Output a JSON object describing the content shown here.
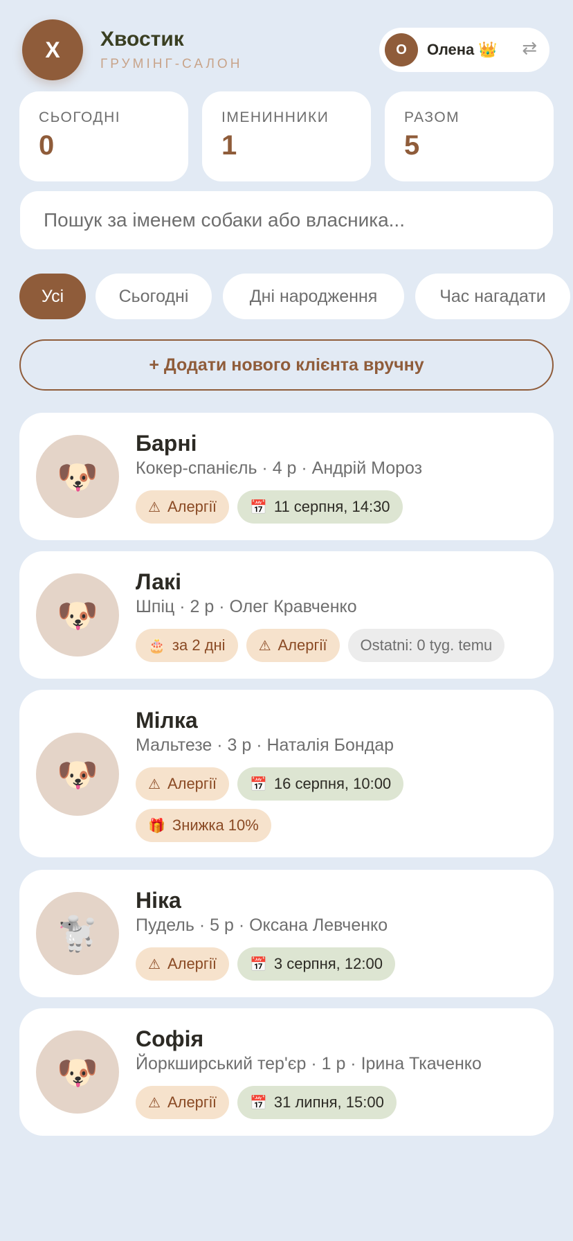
{
  "brand": {
    "initial": "Х",
    "name": "Хвостик",
    "subtitle": "ГРУМІНГ-САЛОН"
  },
  "user": {
    "initial": "О",
    "name": "Олена 👑",
    "switch_icon": "⇄"
  },
  "stats": [
    {
      "label": "СЬОГОДНІ",
      "value": "0"
    },
    {
      "label": "ІМЕНИННИКИ",
      "value": "1"
    },
    {
      "label": "РАЗОМ",
      "value": "5"
    }
  ],
  "search": {
    "placeholder": "Пошук за іменем собаки або власника..."
  },
  "filters": [
    "Усі",
    "Сьогодні",
    "Дні народження",
    "Час нагадати"
  ],
  "add_button": "+ Додати нового клієнта вручну",
  "clients": [
    {
      "avatar": "🐶",
      "name": "Барні",
      "meta": "Кокер-спанієль · 4 р · Андрій Мороз",
      "tags": [
        {
          "kind": "allergy",
          "icon": "⚠",
          "text": "Алергії"
        },
        {
          "kind": "date",
          "icon": "📅",
          "text": "11 серпня, 14:30"
        }
      ]
    },
    {
      "avatar": "🐶",
      "name": "Лакі",
      "meta": "Шпіц · 2 р · Олег Кравченко",
      "tags": [
        {
          "kind": "birthday",
          "icon": "🎂",
          "text": "за 2 дні"
        },
        {
          "kind": "allergy",
          "icon": "⚠",
          "text": "Алергії"
        },
        {
          "kind": "last",
          "icon": "",
          "text": "Ostatni: 0 tyg. temu"
        }
      ]
    },
    {
      "avatar": "🐶",
      "name": "Мілка",
      "meta": "Мальтезе · 3 р · Наталія Бондар",
      "tags": [
        {
          "kind": "allergy",
          "icon": "⚠",
          "text": "Алергії"
        },
        {
          "kind": "date",
          "icon": "📅",
          "text": "16 серпня, 10:00"
        },
        {
          "kind": "discount",
          "icon": "🎁",
          "text": "Знижка 10%"
        }
      ]
    },
    {
      "avatar": "🐩",
      "name": "Ніка",
      "meta": "Пудель · 5 р · Оксана Левченко",
      "tags": [
        {
          "kind": "allergy",
          "icon": "⚠",
          "text": "Алергії"
        },
        {
          "kind": "date",
          "icon": "📅",
          "text": "3 серпня, 12:00"
        }
      ]
    },
    {
      "avatar": "🐶",
      "name": "Софія",
      "meta": "Йоркширський тер'єр · 1 р · Ірина Ткаченко",
      "tags": [
        {
          "kind": "allergy",
          "icon": "⚠",
          "text": "Алергії"
        },
        {
          "kind": "date",
          "icon": "📅",
          "text": "31 липня, 15:00"
        }
      ]
    }
  ],
  "colors": {
    "accent": "#8f5c3a",
    "background": "#e2eaf4",
    "allergy_bg": "#f6e2cc",
    "date_bg": "#dde5d2"
  }
}
